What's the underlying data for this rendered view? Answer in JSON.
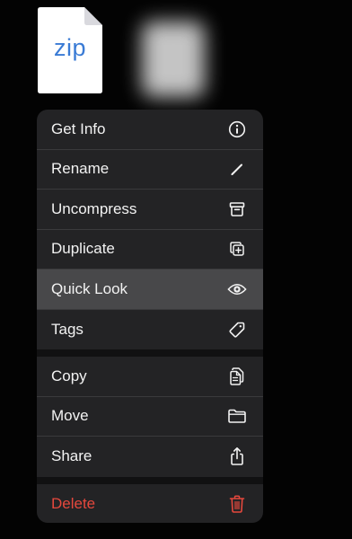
{
  "file": {
    "extension_label": "zip",
    "accent_color": "#3a7bd5"
  },
  "menu": {
    "groups": [
      [
        {
          "label": "Get Info",
          "icon": "info-circle-icon"
        },
        {
          "label": "Rename",
          "icon": "pencil-icon"
        },
        {
          "label": "Uncompress",
          "icon": "archivebox-icon"
        },
        {
          "label": "Duplicate",
          "icon": "plus-square-on-square-icon"
        },
        {
          "label": "Quick Look",
          "icon": "eye-icon",
          "highlighted": true
        },
        {
          "label": "Tags",
          "icon": "tag-icon"
        }
      ],
      [
        {
          "label": "Copy",
          "icon": "doc-on-doc-icon"
        },
        {
          "label": "Move",
          "icon": "folder-icon"
        },
        {
          "label": "Share",
          "icon": "share-icon"
        }
      ],
      [
        {
          "label": "Delete",
          "icon": "trash-icon",
          "destructive": true
        }
      ]
    ],
    "destructive_color": "#e5483d",
    "highlight_color": "#48484a"
  }
}
